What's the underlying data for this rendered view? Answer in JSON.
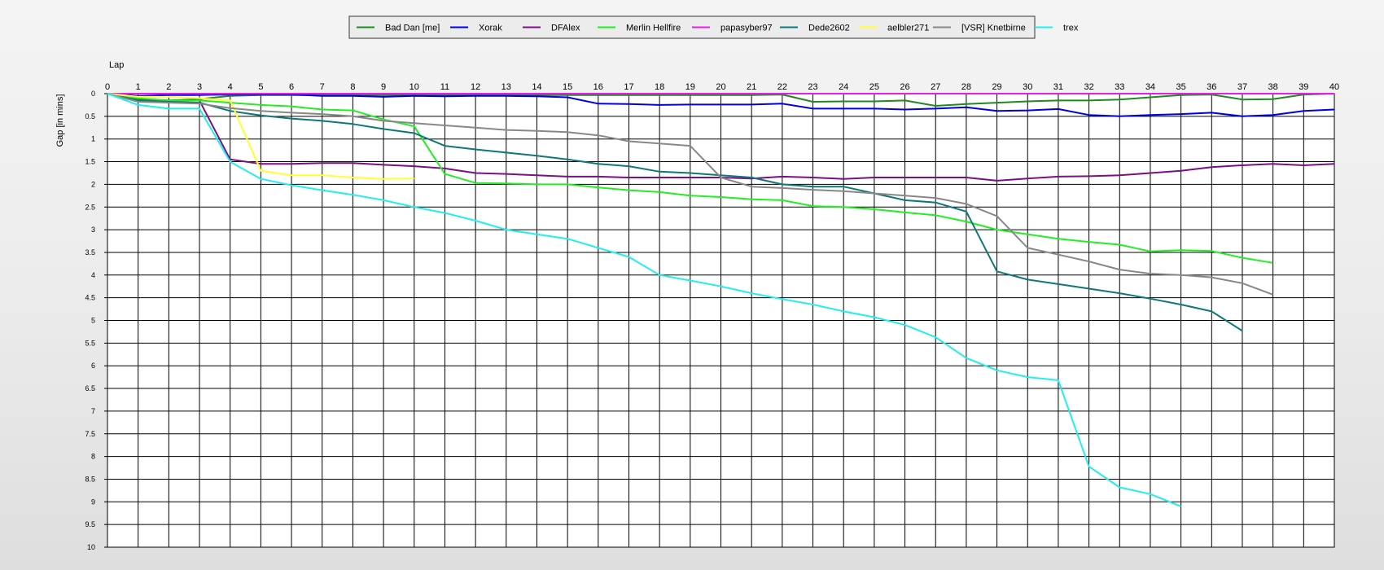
{
  "chart_data": {
    "type": "line",
    "title": "",
    "xlabel": "Lap",
    "ylabel": "Gap [in mins]",
    "xlim": [
      0,
      40
    ],
    "ylim": [
      0,
      10
    ],
    "y_inverted": true,
    "grid": true,
    "legend_position": "top-center",
    "x_ticks": [
      0,
      1,
      2,
      3,
      4,
      5,
      6,
      7,
      8,
      9,
      10,
      11,
      12,
      13,
      14,
      15,
      16,
      17,
      18,
      19,
      20,
      21,
      22,
      23,
      24,
      25,
      26,
      27,
      28,
      29,
      30,
      31,
      32,
      33,
      34,
      35,
      36,
      37,
      38,
      39,
      40
    ],
    "y_ticks": [
      "0",
      "0.5",
      "1",
      "1.5",
      "2",
      "2.5",
      "3",
      "3.5",
      "4",
      "4.5",
      "5",
      "5.5",
      "6",
      "6.5",
      "7",
      "7.5",
      "8",
      "8.5",
      "9",
      "9.5",
      "10"
    ],
    "series": [
      {
        "name": "Bad Dan [me]",
        "color": "#1e8b1e",
        "x": [
          0,
          1,
          2,
          3,
          4,
          5,
          6,
          7,
          8,
          9,
          10,
          11,
          12,
          13,
          14,
          15,
          16,
          17,
          18,
          19,
          20,
          21,
          22,
          23,
          24,
          25,
          26,
          27,
          28,
          29,
          30,
          31,
          32,
          33,
          34,
          35,
          36,
          37,
          38,
          39,
          40
        ],
        "y": [
          0,
          0.12,
          0.15,
          0.12,
          0.05,
          0.03,
          0.03,
          0.03,
          0.03,
          0.03,
          0.03,
          0.03,
          0.03,
          0.03,
          0.03,
          0.03,
          0.03,
          0.03,
          0.03,
          0.03,
          0.03,
          0.03,
          0.02,
          0.18,
          0.17,
          0.17,
          0.15,
          0.27,
          0.23,
          0.2,
          0.17,
          0.15,
          0.15,
          0.13,
          0.08,
          0.03,
          0.02,
          0.13,
          0.12,
          0.02,
          0
        ]
      },
      {
        "name": "Xorak",
        "color": "#0000e6",
        "x": [
          0,
          1,
          2,
          3,
          4,
          5,
          6,
          7,
          8,
          9,
          10,
          11,
          12,
          13,
          14,
          15,
          16,
          17,
          18,
          19,
          20,
          21,
          22,
          23,
          24,
          25,
          26,
          27,
          28,
          29,
          30,
          31,
          32,
          33,
          34,
          35,
          36,
          37,
          38,
          39,
          40
        ],
        "y": [
          0,
          0.05,
          0.03,
          0.03,
          0.02,
          0.02,
          0.02,
          0.05,
          0.05,
          0.07,
          0.05,
          0.06,
          0.05,
          0.05,
          0.06,
          0.08,
          0.22,
          0.23,
          0.25,
          0.24,
          0.24,
          0.24,
          0.22,
          0.33,
          0.33,
          0.33,
          0.35,
          0.33,
          0.3,
          0.38,
          0.37,
          0.34,
          0.47,
          0.5,
          0.47,
          0.45,
          0.42,
          0.5,
          0.47,
          0.38,
          0.35
        ]
      },
      {
        "name": "DFAlex",
        "color": "#7a0f86",
        "x": [
          0,
          1,
          2,
          3,
          4,
          5,
          6,
          7,
          8,
          9,
          10,
          11,
          12,
          13,
          14,
          15,
          16,
          17,
          18,
          19,
          20,
          21,
          22,
          23,
          24,
          25,
          26,
          27,
          28,
          29,
          30,
          31,
          32,
          33,
          34,
          35,
          36,
          37,
          38,
          39,
          40
        ],
        "y": [
          0,
          0.15,
          0.15,
          0.15,
          1.45,
          1.55,
          1.55,
          1.53,
          1.53,
          1.57,
          1.6,
          1.65,
          1.75,
          1.77,
          1.8,
          1.83,
          1.83,
          1.85,
          1.85,
          1.85,
          1.85,
          1.87,
          1.83,
          1.85,
          1.88,
          1.85,
          1.85,
          1.85,
          1.85,
          1.92,
          1.87,
          1.83,
          1.82,
          1.8,
          1.75,
          1.7,
          1.62,
          1.58,
          1.55,
          1.58,
          1.55
        ]
      },
      {
        "name": "Merlin Hellfire",
        "color": "#22ee22",
        "x": [
          0,
          1,
          2,
          3,
          4,
          5,
          6,
          7,
          8,
          9,
          10,
          11,
          12,
          13,
          14,
          15,
          16,
          17,
          18,
          19,
          20,
          21,
          22,
          23,
          24,
          25,
          26,
          27,
          28,
          29,
          30,
          31,
          32,
          33,
          34,
          35,
          36,
          37,
          38
        ],
        "y": [
          0,
          0.1,
          0.15,
          0.15,
          0.2,
          0.25,
          0.28,
          0.35,
          0.37,
          0.57,
          0.72,
          1.77,
          1.97,
          1.98,
          2.0,
          2.0,
          2.07,
          2.13,
          2.17,
          2.25,
          2.28,
          2.33,
          2.35,
          2.48,
          2.5,
          2.55,
          2.62,
          2.68,
          2.82,
          3.0,
          3.1,
          3.2,
          3.27,
          3.33,
          3.48,
          3.45,
          3.47,
          3.62,
          3.73
        ]
      },
      {
        "name": "papasyber97",
        "color": "#e61ee6",
        "x": [
          0,
          40
        ],
        "y": [
          0,
          0
        ]
      },
      {
        "name": "Dede2602",
        "color": "#0e7878",
        "x": [
          0,
          1,
          2,
          3,
          4,
          5,
          6,
          7,
          8,
          9,
          10,
          11,
          12,
          13,
          14,
          15,
          16,
          17,
          18,
          19,
          20,
          21,
          22,
          23,
          24,
          25,
          26,
          27,
          28,
          29,
          30,
          31,
          32,
          33,
          34,
          35,
          36,
          37
        ],
        "y": [
          0,
          0.15,
          0.18,
          0.2,
          0.38,
          0.48,
          0.55,
          0.6,
          0.67,
          0.78,
          0.87,
          1.15,
          1.23,
          1.3,
          1.37,
          1.45,
          1.55,
          1.6,
          1.72,
          1.75,
          1.8,
          1.85,
          2.0,
          2.05,
          2.05,
          2.2,
          2.35,
          2.4,
          2.6,
          3.92,
          4.1,
          4.2,
          4.3,
          4.4,
          4.52,
          4.65,
          4.8,
          5.23
        ]
      },
      {
        "name": "aelbler271",
        "color": "#ffff33",
        "x": [
          0,
          1,
          2,
          3,
          4,
          5,
          6,
          7,
          8,
          9,
          10
        ],
        "y": [
          0,
          0.07,
          0.07,
          0.1,
          0.15,
          1.7,
          1.8,
          1.8,
          1.85,
          1.88,
          1.87
        ]
      },
      {
        "name": "[VSR] Knetbirne",
        "color": "#888888",
        "x": [
          0,
          1,
          2,
          3,
          4,
          5,
          6,
          7,
          8,
          9,
          10,
          11,
          12,
          13,
          14,
          15,
          16,
          17,
          18,
          19,
          20,
          21,
          22,
          23,
          24,
          25,
          26,
          27,
          28,
          29,
          30,
          31,
          32,
          33,
          34,
          35,
          36,
          37,
          38
        ],
        "y": [
          0,
          0.18,
          0.2,
          0.22,
          0.32,
          0.38,
          0.42,
          0.45,
          0.5,
          0.6,
          0.65,
          0.7,
          0.75,
          0.8,
          0.82,
          0.85,
          0.92,
          1.05,
          1.1,
          1.15,
          1.85,
          2.05,
          2.08,
          2.12,
          2.15,
          2.2,
          2.25,
          2.3,
          2.43,
          2.7,
          3.4,
          3.55,
          3.7,
          3.88,
          3.97,
          4.0,
          4.05,
          4.18,
          4.43
        ]
      },
      {
        "name": "trex",
        "color": "#22eeee",
        "x": [
          0,
          1,
          2,
          3,
          4,
          5,
          6,
          7,
          8,
          9,
          10,
          11,
          12,
          13,
          14,
          15,
          16,
          17,
          18,
          19,
          20,
          21,
          22,
          23,
          24,
          25,
          26,
          27,
          28,
          29,
          30,
          31,
          32,
          33,
          34,
          35
        ],
        "y": [
          0,
          0.25,
          0.33,
          0.33,
          1.5,
          1.88,
          2.02,
          2.13,
          2.23,
          2.35,
          2.5,
          2.63,
          2.8,
          3.0,
          3.1,
          3.2,
          3.4,
          3.6,
          4.0,
          4.12,
          4.25,
          4.4,
          4.53,
          4.65,
          4.8,
          4.93,
          5.1,
          5.37,
          5.83,
          6.1,
          6.25,
          6.32,
          8.22,
          8.68,
          8.83,
          9.1
        ]
      }
    ]
  }
}
